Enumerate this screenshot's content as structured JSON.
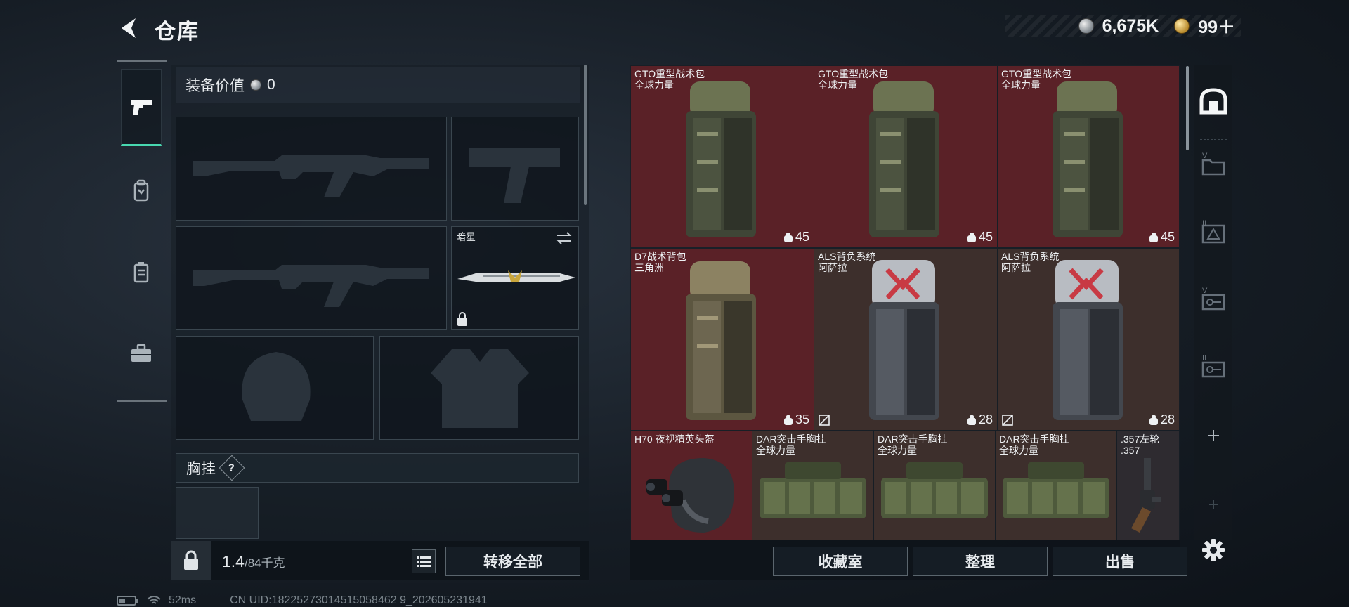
{
  "header": {
    "title": "仓库",
    "silver_amount": "6,675K",
    "gold_amount": "99＋"
  },
  "left": {
    "equip_value_label": "装备价值",
    "equip_value": "0",
    "melee_name": "暗星",
    "chest_label": "胸挂",
    "chest_help": "?",
    "weight_current": "1.4",
    "weight_max": "/84千克",
    "transfer_all": "转移全部"
  },
  "stash": {
    "items": [
      {
        "name": "GTO重型战术包",
        "sub": "全球力量",
        "count": "45",
        "color": "red"
      },
      {
        "name": "GTO重型战术包",
        "sub": "全球力量",
        "count": "45",
        "color": "red"
      },
      {
        "name": "GTO重型战术包",
        "sub": "全球力量",
        "count": "45",
        "color": "red"
      },
      {
        "name": "D7战术背包",
        "sub": "三角洲",
        "count": "35",
        "color": "red"
      },
      {
        "name": "ALS背负系统",
        "sub": "阿萨拉",
        "count": "28",
        "color": "brown"
      },
      {
        "name": "ALS背负系统",
        "sub": "阿萨拉",
        "count": "28",
        "color": "brown"
      },
      {
        "name": "H70 夜视精英头盔",
        "sub": "",
        "color": "red"
      },
      {
        "name": "DAR突击手胸挂",
        "sub": "全球力量",
        "color": "brown"
      },
      {
        "name": "DAR突击手胸挂",
        "sub": "全球力量",
        "color": "brown"
      },
      {
        "name": "DAR突击手胸挂",
        "sub": "全球力量",
        "color": "brown"
      },
      {
        "name": ".357左轮",
        "sub": ".357",
        "color": "dark"
      }
    ],
    "buttons": {
      "collection": "收藏室",
      "sort": "整理",
      "sell": "出售"
    },
    "rail_labels": [
      "IV",
      "III",
      "IV",
      "III"
    ]
  },
  "status": {
    "ping": "52ms",
    "uid": "CN UID:18225273014515058462 9_202605231941"
  },
  "colors": {
    "accent": "#48d8b0",
    "item_red": "#5a2127",
    "item_brown": "#3d2f2c"
  }
}
